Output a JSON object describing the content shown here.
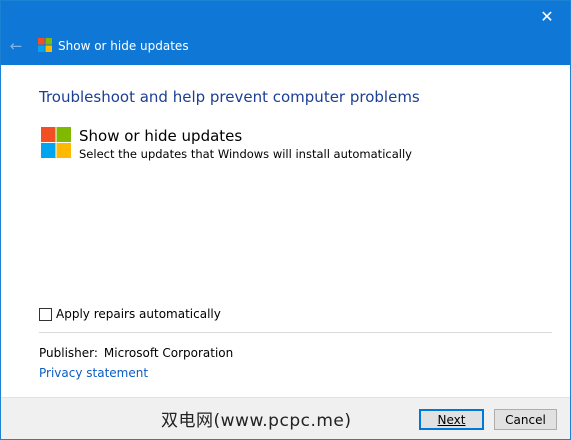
{
  "window": {
    "title": "Show or hide updates",
    "accent_color": "#0f78d7"
  },
  "icons": {
    "close": "close-icon",
    "back": "back-arrow-icon",
    "logo": "windows-logo-icon",
    "logo_colors": [
      "#f25022",
      "#7fba00",
      "#00a4ef",
      "#ffb900"
    ]
  },
  "main": {
    "heading": "Troubleshoot and help prevent computer problems",
    "item_title": "Show or hide updates",
    "item_description": "Select the updates that Windows will install automatically",
    "checkbox_label": "Apply repairs automatically",
    "checkbox_checked": false,
    "publisher_label": "Publisher:",
    "publisher_value": "Microsoft Corporation",
    "privacy_link": "Privacy statement"
  },
  "footer": {
    "watermark": "双电网(www.pcpc.me)",
    "next_label": "Next",
    "cancel_label": "Cancel"
  }
}
